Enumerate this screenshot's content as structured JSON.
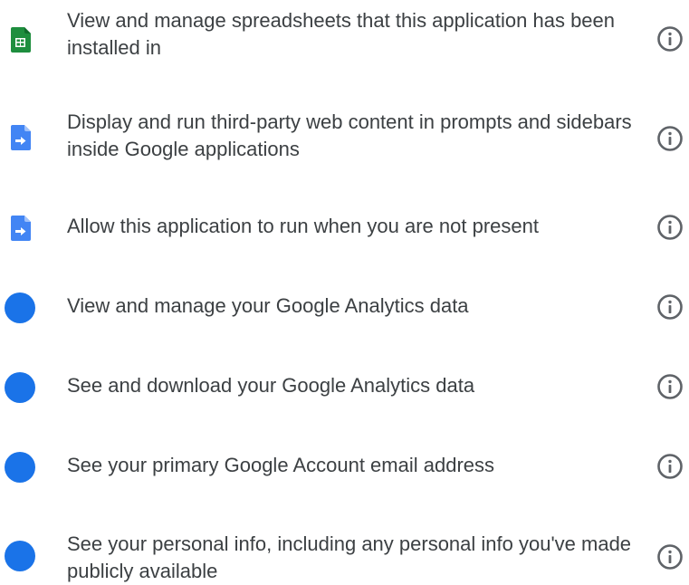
{
  "scopes": [
    {
      "text": "View and manage spreadsheets that this application has been installed in",
      "icon": "sheets-icon"
    },
    {
      "text": "Display and run third-party web content in prompts and sidebars inside Google applications",
      "icon": "apps-script-icon"
    },
    {
      "text": "Allow this application to run when you are not present",
      "icon": "apps-script-icon"
    },
    {
      "text": "View and manage your Google Analytics data",
      "icon": "blue-dot-icon"
    },
    {
      "text": "See and download your Google Analytics data",
      "icon": "blue-dot-icon"
    },
    {
      "text": "See your primary Google Account email address",
      "icon": "blue-dot-icon"
    },
    {
      "text": "See your personal info, including any personal info you've made publicly available",
      "icon": "blue-dot-icon"
    }
  ],
  "colors": {
    "text": "#3c4043",
    "sheets_green": "#1e8e3e",
    "script_blue": "#4285f4",
    "dot_blue": "#1a73e8",
    "info_gray": "#5f6368"
  }
}
